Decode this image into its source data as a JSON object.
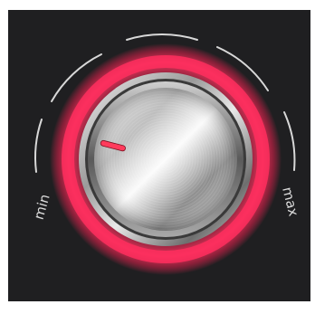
{
  "dial": {
    "min_label": "min",
    "max_label": "max",
    "level": 0.22,
    "ring_color": "#ff2a5a",
    "indicator_color": "#ff3b5c"
  }
}
